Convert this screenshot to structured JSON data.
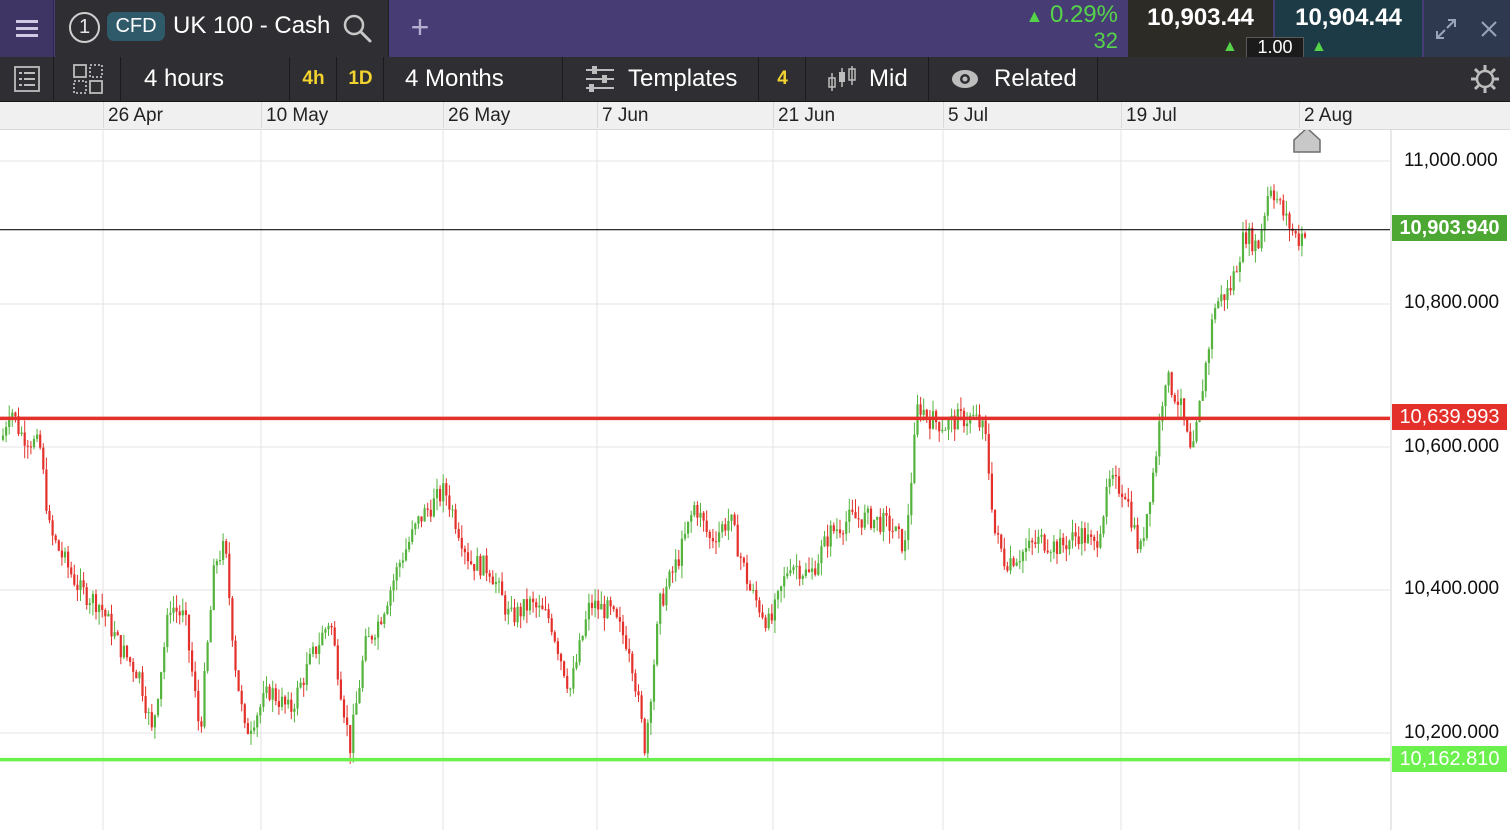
{
  "header": {
    "tab_number": "1",
    "instrument_type": "CFD",
    "instrument_name": "UK 100 - Cash",
    "add_symbol": "+",
    "change_percent": "0.29%",
    "change_points": "32",
    "sell_price": "10,903.44",
    "buy_price": "10,904.44",
    "spread": "1.00",
    "up_color": "#55d44a"
  },
  "toolbar": {
    "interval_label": "4 hours",
    "interval_quick_1": "4h",
    "interval_quick_2": "1D",
    "range_label": "4 Months",
    "templates_label": "Templates",
    "templates_count": "4",
    "price_mode_label": "Mid",
    "related_label": "Related"
  },
  "date_axis": [
    "26 Apr",
    "10 May",
    "26 May",
    "7 Jun",
    "21 Jun",
    "5 Jul",
    "19 Jul",
    "2 Aug"
  ],
  "price_axis": {
    "labels": [
      "11,000.000",
      "10,800.000",
      "10,600.000",
      "10,400.000",
      "10,200.000"
    ],
    "values": [
      11000,
      10800,
      10600,
      10400,
      10200
    ]
  },
  "price_lines": {
    "current": {
      "label": "10,903.940",
      "value": 10903.94,
      "color": "#4ca832"
    },
    "resistance": {
      "label": "10,639.993",
      "value": 10639.993,
      "color": "#e3302a"
    },
    "support": {
      "label": "10,162.810",
      "value": 10162.81,
      "color": "#6cf04d"
    }
  },
  "colors": {
    "bull": "#54b33d",
    "bear": "#e3302a",
    "grid": "#e3e3e3",
    "header_bg": "#473c73"
  },
  "icons": {
    "menu": "hamburger-icon",
    "search": "search-icon",
    "expand": "expand-icon",
    "close": "close-icon",
    "settings": "gear-icon"
  }
}
